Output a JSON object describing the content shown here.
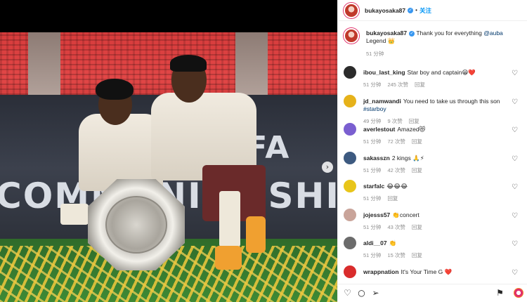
{
  "post": {
    "author": "bukayosaka87",
    "follow_label": "关注",
    "dot": "•"
  },
  "caption": {
    "username": "bukayosaka87",
    "text_before": " Thank you for everything ",
    "mention": "@auba",
    "text_after": " Legend 👑",
    "time": "51 分钟"
  },
  "photo": {
    "board_line1": "THE FA",
    "board_line2": "COMMUNITY SHIELD",
    "next_arrow": "›"
  },
  "comments": [
    {
      "user": "ibou_last_king",
      "text": "Star boy and captain😁❤️",
      "time": "51 分钟",
      "likes": "245 次赞",
      "reply": "回复",
      "avatar_color": "#2b2b2b"
    },
    {
      "user": "jd_namwandi",
      "text": "You need to take us through this son ",
      "hashtag": "#starboy",
      "time": "49 分钟",
      "likes": "9 次赞",
      "reply": "回复",
      "avatar_color": "#e6b21a"
    },
    {
      "user": "averlestout",
      "text": "Amazed😻",
      "time": "51 分钟",
      "likes": "72 次赞",
      "reply": "回复",
      "avatar_color": "#7a5fd0"
    },
    {
      "user": "sakasszn",
      "text": "2 kings 🙏⚡",
      "time": "51 分钟",
      "likes": "42 次赞",
      "reply": "回复",
      "avatar_color": "#3d5a80"
    },
    {
      "user": "starfalc",
      "text": "😂😂😂",
      "time": "51 分钟",
      "likes": "",
      "reply": "回复",
      "avatar_color": "#e8c51a"
    },
    {
      "user": "jojesss57",
      "text": "👏concert",
      "time": "51 分钟",
      "likes": "43 次赞",
      "reply": "回复",
      "avatar_color": "#c9a49a"
    },
    {
      "user": "aldi__07",
      "text": "👏",
      "time": "51 分钟",
      "likes": "15 次赞",
      "reply": "回复",
      "avatar_color": "#6b6b6b"
    },
    {
      "user": "wrappnation",
      "text": "It's Your Time G ❤️",
      "time": "",
      "likes": "",
      "reply": "",
      "avatar_color": "#d92c2c"
    }
  ],
  "icons": {
    "heart": "♡",
    "like": "♡",
    "comment": "○",
    "share": "➢",
    "save": "⚑"
  },
  "colors": {
    "link": "#0095f6",
    "mention": "#00376b",
    "verified": "#3897f0"
  }
}
